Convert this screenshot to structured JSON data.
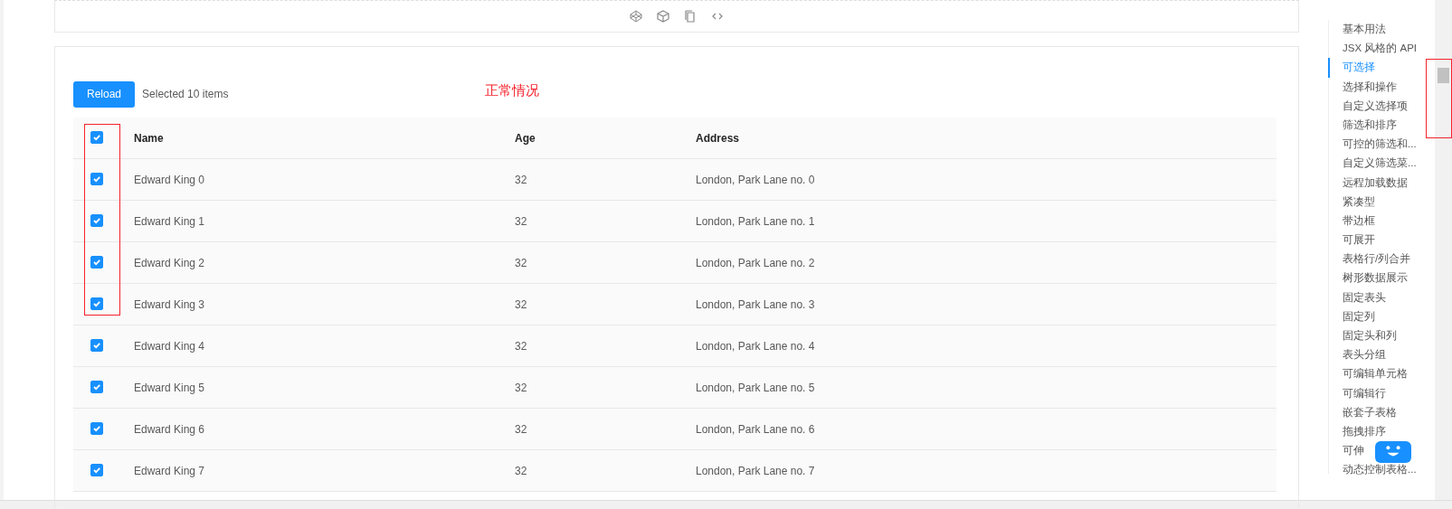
{
  "toolbar": {
    "buttons": [
      {
        "kind": "codepen"
      },
      {
        "kind": "sandbox"
      },
      {
        "kind": "copy"
      },
      {
        "kind": "code"
      }
    ]
  },
  "demo": {
    "reload_button": "Reload",
    "selection_text": "Selected 10 items",
    "annotation": "正常情况",
    "table": {
      "columns": [
        "Name",
        "Age",
        "Address"
      ],
      "header_checked": true,
      "rows": [
        {
          "name": "Edward King 0",
          "age": "32",
          "address": "London, Park Lane no. 0",
          "selected": true
        },
        {
          "name": "Edward King 1",
          "age": "32",
          "address": "London, Park Lane no. 1",
          "selected": true
        },
        {
          "name": "Edward King 2",
          "age": "32",
          "address": "London, Park Lane no. 2",
          "selected": true
        },
        {
          "name": "Edward King 3",
          "age": "32",
          "address": "London, Park Lane no. 3",
          "selected": true
        },
        {
          "name": "Edward King 4",
          "age": "32",
          "address": "London, Park Lane no. 4",
          "selected": true
        },
        {
          "name": "Edward King 5",
          "age": "32",
          "address": "London, Park Lane no. 5",
          "selected": true
        },
        {
          "name": "Edward King 6",
          "age": "32",
          "address": "London, Park Lane no. 6",
          "selected": true
        },
        {
          "name": "Edward King 7",
          "age": "32",
          "address": "London, Park Lane no. 7",
          "selected": true
        }
      ]
    }
  },
  "toc": {
    "items": [
      {
        "label": "基本用法",
        "selected": false
      },
      {
        "label": "JSX 风格的 API",
        "selected": false
      },
      {
        "label": "可选择",
        "selected": true
      },
      {
        "label": "选择和操作",
        "selected": false
      },
      {
        "label": "自定义选择项",
        "selected": false
      },
      {
        "label": "筛选和排序",
        "selected": false
      },
      {
        "label": "可控的筛选和...",
        "selected": false
      },
      {
        "label": "自定义筛选菜...",
        "selected": false
      },
      {
        "label": "远程加载数据",
        "selected": false
      },
      {
        "label": "紧凑型",
        "selected": false
      },
      {
        "label": "带边框",
        "selected": false
      },
      {
        "label": "可展开",
        "selected": false
      },
      {
        "label": "表格行/列合并",
        "selected": false
      },
      {
        "label": "树形数据展示",
        "selected": false
      },
      {
        "label": "固定表头",
        "selected": false
      },
      {
        "label": "固定列",
        "selected": false
      },
      {
        "label": "固定头和列",
        "selected": false
      },
      {
        "label": "表头分组",
        "selected": false
      },
      {
        "label": "可编辑单元格",
        "selected": false
      },
      {
        "label": "可编辑行",
        "selected": false
      },
      {
        "label": "嵌套子表格",
        "selected": false
      },
      {
        "label": "拖拽排序",
        "selected": false
      },
      {
        "label": "可伸",
        "selected": false
      },
      {
        "label": "动态控制表格...",
        "selected": false
      }
    ]
  }
}
